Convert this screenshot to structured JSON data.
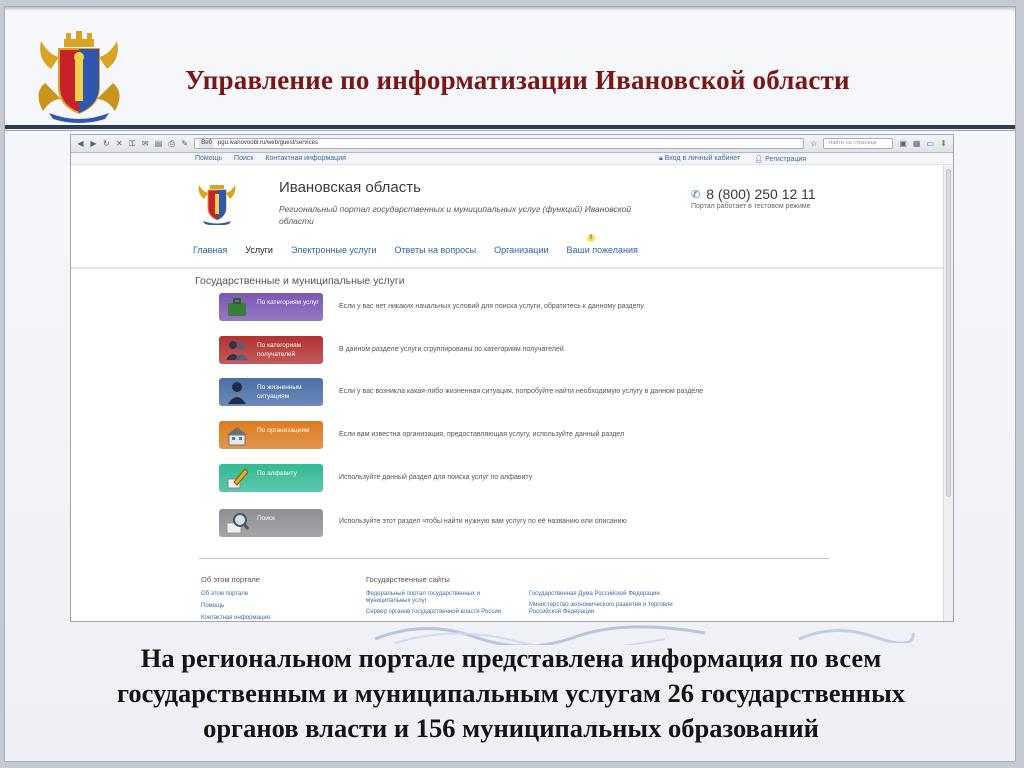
{
  "slide": {
    "title": "Управление по информатизации Ивановской области",
    "caption_lines": [
      "На региональном портале представлена информация по всем",
      "государственным и муниципальным услугам 26 государственных",
      "органов власти и 156 муниципальных образований"
    ]
  },
  "browser": {
    "url_site": "Веб",
    "url": "pgu.ivanovoobl.ru/web/guest/services",
    "search_placeholder": "Найти на странице"
  },
  "topnav": {
    "left": [
      "Помощь",
      "Поиск",
      "Контактная информация"
    ],
    "login": "Вход в личный кабинет",
    "register": "Регистрация"
  },
  "portal": {
    "name": "Ивановская область",
    "subtitle": "Региональный портал государственных и муниципальных услуг (функций) Ивановской области",
    "phone": "8 (800) 250 12 11",
    "phone_note": "Портал работает в тестовом режиме"
  },
  "mainnav": [
    "Главная",
    "Услуги",
    "Электронные услуги",
    "Ответы на вопросы",
    "Организации",
    "Ваши пожелания"
  ],
  "section_title": "Государственные и муниципальные услуги",
  "services": [
    {
      "label": "По категориям услуг",
      "desc": "Если у вас нет никаких начальных условий для поиска услуги, обратитесь к данному разделу",
      "color": "#7b57b3"
    },
    {
      "label": "По категориям получателей",
      "desc": "В данном разделе услуги сгруппированы по категориям получателей",
      "color": "#b33131"
    },
    {
      "label": "По жизненным ситуациям",
      "desc": "Если у вас возникла какая-либо жизненная ситуация, попробуйте найти необходимую услугу в данном разделе",
      "color": "#4a6ea7"
    },
    {
      "label": "По организациям",
      "desc": "Если вам известна организация, предоставляющая услугу, используйте данный раздел",
      "color": "#dc7b1f"
    },
    {
      "label": "По алфавиту",
      "desc": "Используйте данный раздел для поиска услуг по алфавиту",
      "color": "#34b995"
    },
    {
      "label": "Поиск",
      "desc": "Используйте этот раздел чтобы найти нужную вам услугу по её названию или описанию",
      "color": "#8d8f92"
    }
  ],
  "footer": {
    "about_heading": "Об этом портале",
    "about_links": [
      "Об этом портале",
      "Помощь",
      "Контактная информация"
    ],
    "sites_heading": "Государственные сайты",
    "sites_col1": [
      "Федеральный портал государственных и муниципальных услуг",
      "Сервер органов государственной власти России"
    ],
    "sites_col2": [
      "Государственная Дума Российской Федерации",
      "Министерство экономического развития и торговли Российской Федерации"
    ]
  }
}
